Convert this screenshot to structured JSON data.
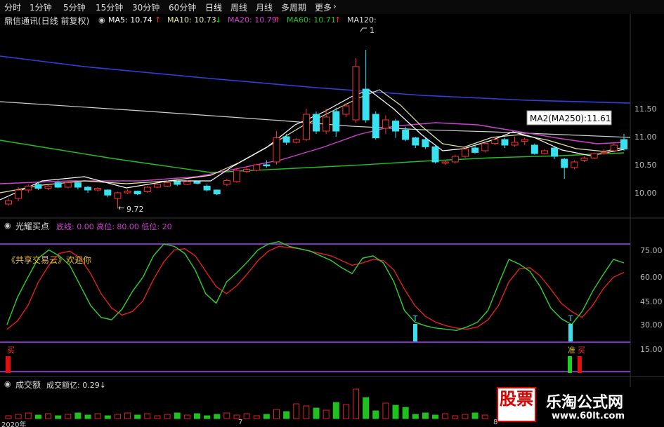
{
  "toolbar": {
    "tabs": [
      "分时",
      "1分钟",
      "5分钟",
      "15分钟",
      "30分钟",
      "60分钟",
      "日线",
      "周线",
      "月线",
      "多周期",
      "更多"
    ],
    "active_tab": "日线",
    "arrow_icon": "chevron-right-icon"
  },
  "main_panel": {
    "stock_title": "鼎信通讯(日线 前复权)",
    "ma": [
      {
        "label": "MA5: 10.74",
        "color": "#ffffff",
        "arrow": "↑",
        "arrow_color": "#ff3030"
      },
      {
        "label": "MA10: 10.73",
        "color": "#e8e8a0",
        "arrow": "↓",
        "arrow_color": "#00e000"
      },
      {
        "label": "MA20: 10.79",
        "color": "#d040d0",
        "arrow": "↑",
        "arrow_color": "#ff3030"
      },
      {
        "label": "MA60: 10.71",
        "color": "#20c020",
        "arrow": "↑",
        "arrow_color": "#ff3030"
      },
      {
        "label": "MA120:",
        "color": "#dddddd",
        "arrow": "",
        "arrow_color": "#ff3030"
      }
    ],
    "tooltip": "MA2(MA250):11.61",
    "low_label": "9.72",
    "high_label": "1",
    "price_axis": [
      "11.50",
      "11.00",
      "10.50",
      "10.00"
    ],
    "candles": [
      {
        "o": 9.8,
        "c": 9.86,
        "h": 9.9,
        "l": 9.77
      },
      {
        "o": 9.9,
        "c": 10.05,
        "h": 10.1,
        "l": 9.85
      },
      {
        "o": 10.05,
        "c": 10.12,
        "h": 10.15,
        "l": 10.0
      },
      {
        "o": 10.15,
        "c": 10.08,
        "h": 10.2,
        "l": 10.05
      },
      {
        "o": 10.08,
        "c": 10.12,
        "h": 10.14,
        "l": 10.05
      },
      {
        "o": 10.18,
        "c": 10.1,
        "h": 10.22,
        "l": 10.08
      },
      {
        "o": 10.1,
        "c": 10.18,
        "h": 10.22,
        "l": 10.08
      },
      {
        "o": 10.18,
        "c": 10.1,
        "h": 10.2,
        "l": 10.06
      },
      {
        "o": 10.1,
        "c": 10.05,
        "h": 10.12,
        "l": 10.0
      },
      {
        "o": 10.05,
        "c": 10.08,
        "h": 10.1,
        "l": 10.02
      },
      {
        "o": 10.05,
        "c": 9.96,
        "h": 10.06,
        "l": 9.92
      },
      {
        "o": 9.9,
        "c": 10.0,
        "h": 10.02,
        "l": 9.72
      },
      {
        "o": 10.0,
        "c": 10.03,
        "h": 10.06,
        "l": 9.98
      },
      {
        "o": 10.03,
        "c": 9.98,
        "h": 10.04,
        "l": 9.96
      },
      {
        "o": 10.02,
        "c": 10.1,
        "h": 10.12,
        "l": 10.0
      },
      {
        "o": 10.1,
        "c": 10.15,
        "h": 10.18,
        "l": 10.08
      },
      {
        "o": 10.12,
        "c": 10.18,
        "h": 10.22,
        "l": 10.1
      },
      {
        "o": 10.2,
        "c": 10.15,
        "h": 10.22,
        "l": 10.12
      },
      {
        "o": 10.15,
        "c": 10.2,
        "h": 10.22,
        "l": 10.14
      },
      {
        "o": 10.2,
        "c": 10.17,
        "h": 10.22,
        "l": 10.15
      },
      {
        "o": 10.12,
        "c": 10.05,
        "h": 10.15,
        "l": 10.02
      },
      {
        "o": 10.05,
        "c": 9.98,
        "h": 10.06,
        "l": 9.96
      },
      {
        "o": 10.15,
        "c": 10.22,
        "h": 10.25,
        "l": 10.12
      },
      {
        "o": 10.2,
        "c": 10.4,
        "h": 10.45,
        "l": 10.18
      },
      {
        "o": 10.38,
        "c": 10.42,
        "h": 10.48,
        "l": 10.35
      },
      {
        "o": 10.4,
        "c": 10.5,
        "h": 10.52,
        "l": 10.38
      },
      {
        "o": 10.5,
        "c": 10.48,
        "h": 10.58,
        "l": 10.45
      },
      {
        "o": 10.55,
        "c": 10.98,
        "h": 11.1,
        "l": 10.5
      },
      {
        "o": 11.0,
        "c": 10.9,
        "h": 11.05,
        "l": 10.85
      },
      {
        "o": 10.9,
        "c": 10.95,
        "h": 10.98,
        "l": 10.88
      },
      {
        "o": 10.95,
        "c": 11.4,
        "h": 11.5,
        "l": 10.92
      },
      {
        "o": 11.4,
        "c": 11.1,
        "h": 11.45,
        "l": 11.05
      },
      {
        "o": 11.1,
        "c": 11.35,
        "h": 11.5,
        "l": 11.05
      },
      {
        "o": 11.45,
        "c": 11.1,
        "h": 11.52,
        "l": 11.0
      },
      {
        "o": 11.4,
        "c": 11.55,
        "h": 11.6,
        "l": 11.35
      },
      {
        "o": 11.3,
        "c": 12.25,
        "h": 12.4,
        "l": 11.25
      },
      {
        "o": 11.85,
        "c": 11.3,
        "h": 12.55,
        "l": 11.25
      },
      {
        "o": 11.4,
        "c": 10.98,
        "h": 11.45,
        "l": 10.95
      },
      {
        "o": 11.15,
        "c": 11.3,
        "h": 11.38,
        "l": 11.05
      },
      {
        "o": 11.28,
        "c": 11.1,
        "h": 11.32,
        "l": 10.98
      },
      {
        "o": 11.12,
        "c": 10.95,
        "h": 11.18,
        "l": 10.92
      },
      {
        "o": 10.98,
        "c": 10.85,
        "h": 11.0,
        "l": 10.8
      },
      {
        "o": 10.95,
        "c": 10.82,
        "h": 10.98,
        "l": 10.78
      },
      {
        "o": 10.82,
        "c": 10.55,
        "h": 10.85,
        "l": 10.52
      },
      {
        "o": 10.55,
        "c": 10.55,
        "h": 10.58,
        "l": 10.5
      },
      {
        "o": 10.55,
        "c": 10.65,
        "h": 10.68,
        "l": 10.52
      },
      {
        "o": 10.65,
        "c": 10.78,
        "h": 10.82,
        "l": 10.62
      },
      {
        "o": 10.8,
        "c": 10.72,
        "h": 10.85,
        "l": 10.7
      },
      {
        "o": 10.75,
        "c": 10.88,
        "h": 10.92,
        "l": 10.72
      },
      {
        "o": 10.88,
        "c": 10.95,
        "h": 10.98,
        "l": 10.85
      },
      {
        "o": 10.95,
        "c": 10.85,
        "h": 10.98,
        "l": 10.8
      },
      {
        "o": 10.85,
        "c": 10.9,
        "h": 11.0,
        "l": 10.82
      },
      {
        "o": 10.92,
        "c": 10.95,
        "h": 10.98,
        "l": 10.85
      },
      {
        "o": 10.85,
        "c": 10.7,
        "h": 10.88,
        "l": 10.68
      },
      {
        "o": 10.7,
        "c": 10.75,
        "h": 10.78,
        "l": 10.68
      },
      {
        "o": 10.8,
        "c": 10.65,
        "h": 10.82,
        "l": 10.6
      },
      {
        "o": 10.6,
        "c": 10.45,
        "h": 10.62,
        "l": 10.25
      },
      {
        "o": 10.45,
        "c": 10.55,
        "h": 10.58,
        "l": 10.42
      },
      {
        "o": 10.58,
        "c": 10.62,
        "h": 10.65,
        "l": 10.55
      },
      {
        "o": 10.62,
        "c": 10.7,
        "h": 10.72,
        "l": 10.6
      },
      {
        "o": 10.7,
        "c": 10.72,
        "h": 10.78,
        "l": 10.68
      },
      {
        "o": 10.75,
        "c": 10.85,
        "h": 10.88,
        "l": 10.72
      },
      {
        "o": 10.95,
        "c": 10.78,
        "h": 11.05,
        "l": 10.75
      }
    ],
    "up_color": "#ff3030",
    "down_color": "#38e0f0"
  },
  "indicator_panel": {
    "title": "光耀买点",
    "params": "底线: 0.00  高位: 80.00  低位: 20",
    "watermark": "《共享交易云》欢迎你",
    "axis": [
      "75.00",
      "60.00",
      "45.00",
      "30.00",
      "15.00"
    ],
    "t_label": "T",
    "buy_label": "买",
    "prepare_label": "准",
    "green_line": [
      22,
      45,
      62,
      78,
      85,
      80,
      72,
      55,
      38,
      28,
      26,
      35,
      50,
      62,
      80,
      90,
      88,
      82,
      68,
      48,
      40,
      58,
      66,
      75,
      85,
      90,
      92,
      88,
      86,
      84,
      80,
      76,
      70,
      65,
      78,
      80,
      74,
      58,
      34,
      24,
      21,
      19,
      18,
      17,
      20,
      24,
      34,
      56,
      77,
      73,
      67,
      54,
      36,
      27,
      22,
      33,
      50,
      64,
      77,
      74
    ],
    "red_line": [
      18,
      25,
      38,
      58,
      72,
      82,
      84,
      78,
      65,
      48,
      36,
      30,
      33,
      42,
      60,
      75,
      85,
      86,
      80,
      67,
      54,
      48,
      55,
      65,
      76,
      84,
      88,
      87,
      86,
      84,
      82,
      80,
      76,
      72,
      74,
      77,
      76,
      68,
      52,
      38,
      29,
      24,
      21,
      19,
      18,
      20,
      26,
      38,
      58,
      69,
      70,
      63,
      52,
      40,
      33,
      28,
      38,
      52,
      62,
      66
    ]
  },
  "volume_panel": {
    "title": "成交额",
    "subtitle": "成交额亿: 0.29↓",
    "date_2020": "2020年",
    "date_7": "7",
    "date_8": "8"
  },
  "watermark": {
    "logo_text": "股票",
    "site_name": "乐淘公式网",
    "site_url": "www.60lt.com"
  }
}
